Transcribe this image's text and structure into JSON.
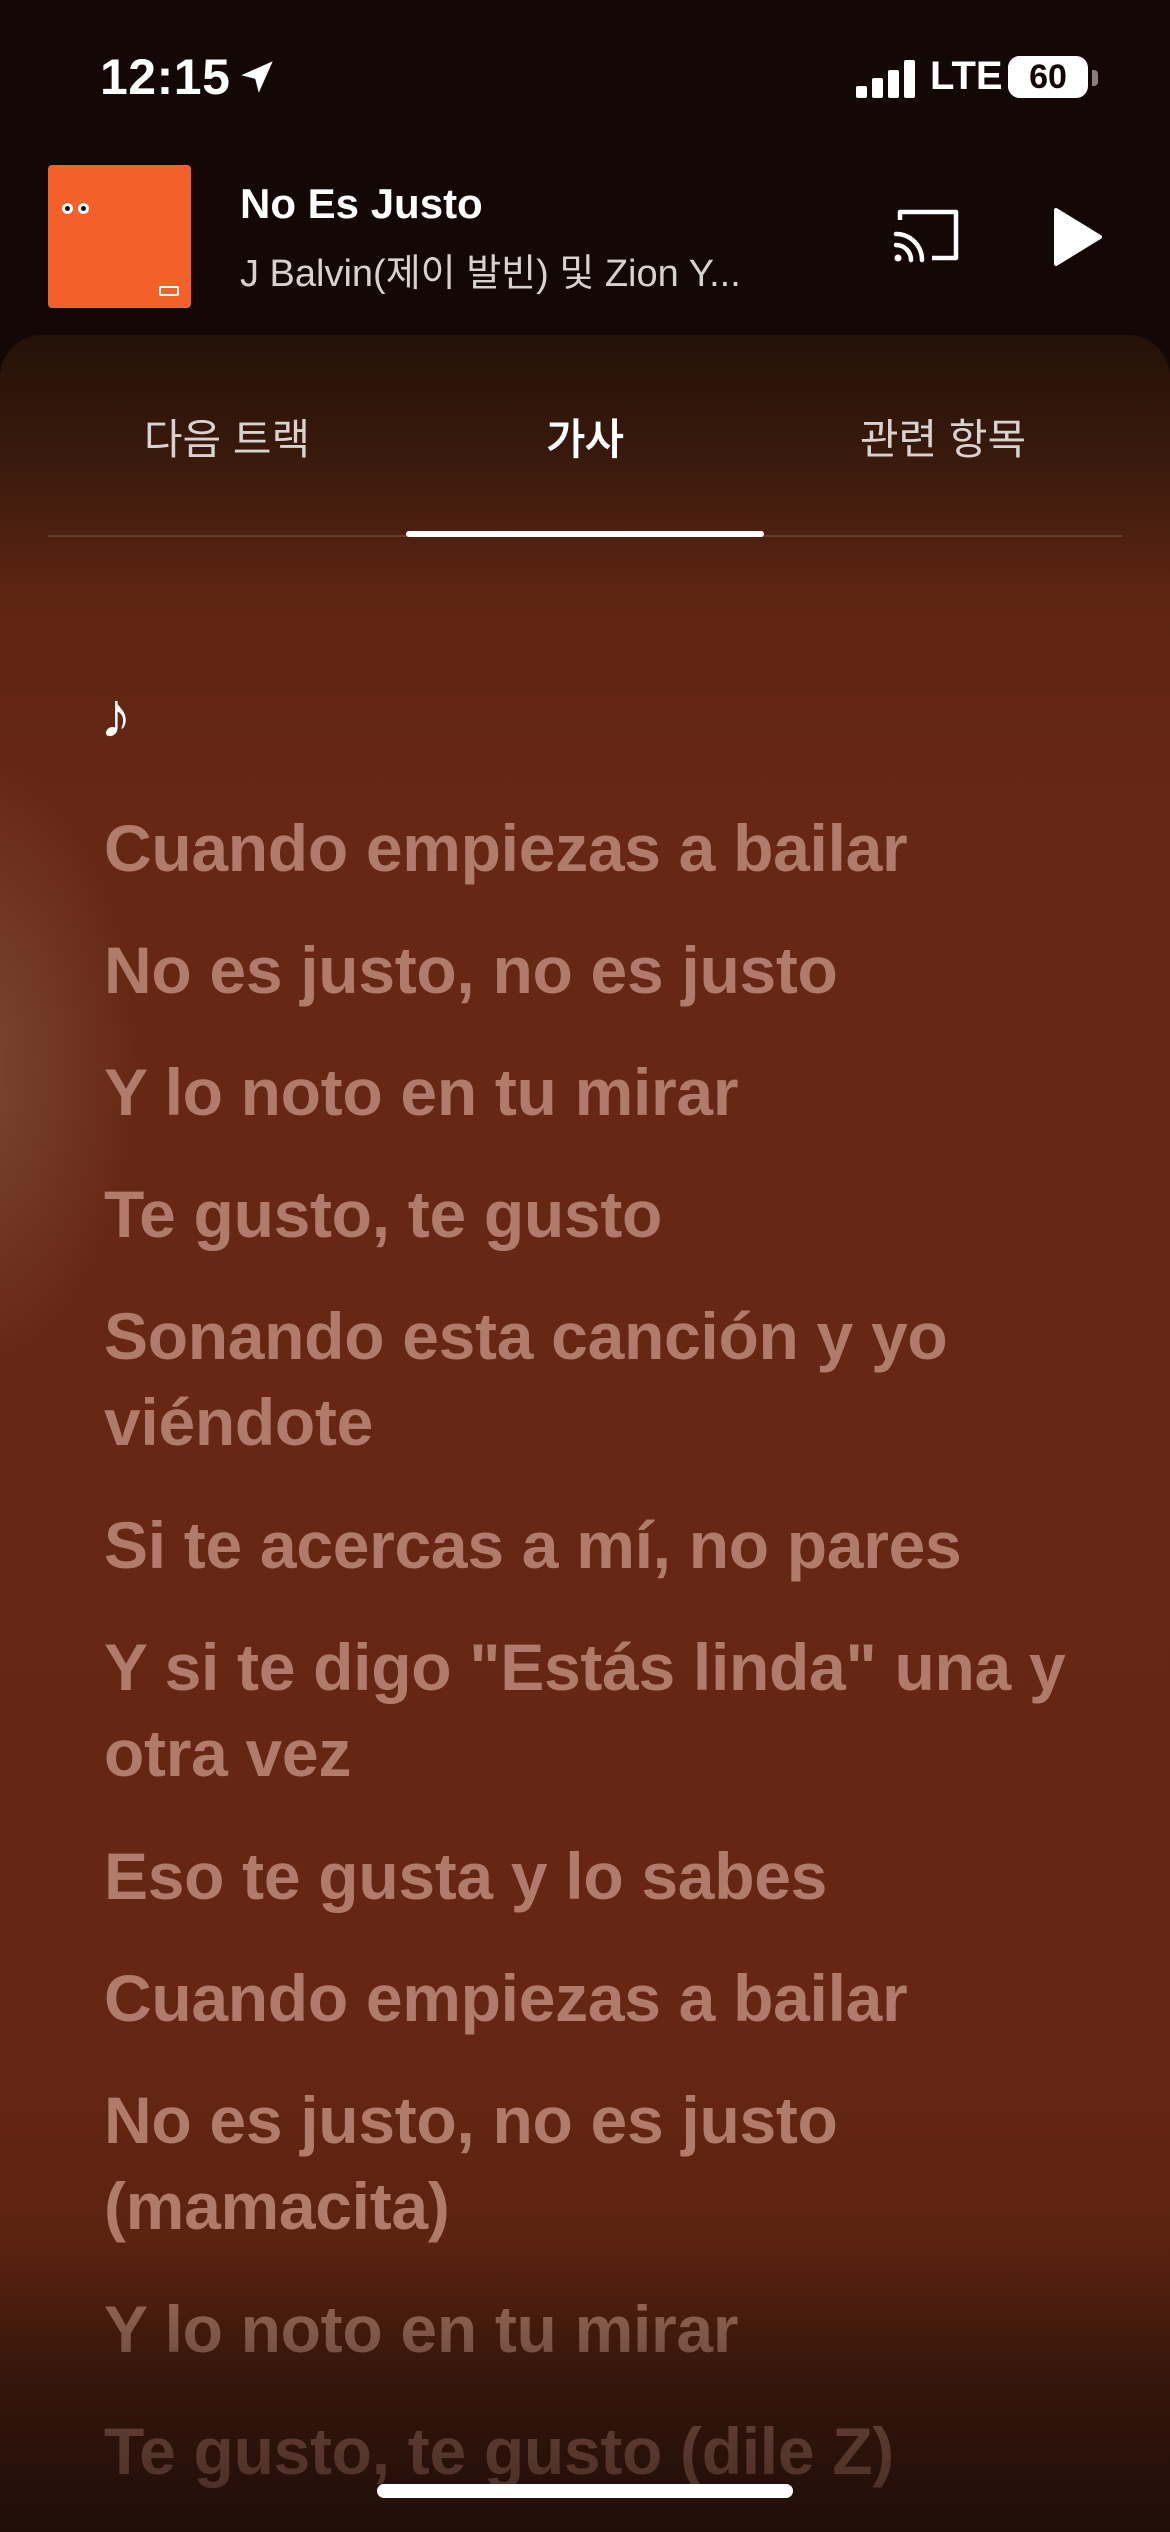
{
  "status_bar": {
    "time": "12:15",
    "network": "LTE",
    "battery": "60",
    "battery_level_percent": 60,
    "location_icon": "location-arrow-icon",
    "signal_icon": "cellular-signal-icon"
  },
  "mini_player": {
    "title": "No Es Justo",
    "artist": "J Balvin(제이 발빈) 및 Zion Y...",
    "album_art_color": "#f4602a",
    "cast_icon": "cast-icon",
    "play_icon": "play-icon"
  },
  "tabs": [
    {
      "label": "다음 트랙",
      "active": false
    },
    {
      "label": "가사",
      "active": true
    },
    {
      "label": "관련 항목",
      "active": false
    }
  ],
  "lyrics": {
    "intro_symbol": "♪",
    "lines": [
      "Cuando empiezas a bailar",
      "No es justo, no es justo",
      "Y lo noto en tu mirar",
      "Te gusto, te gusto",
      "Sonando esta canción y yo viéndote",
      "Si te acercas a mí, no pares",
      "Y si te digo \"Estás linda\" una y otra vez",
      "Eso te gusta y lo sabes",
      "Cuando empiezas a bailar",
      "No es justo, no es justo (mamacita)",
      "Y lo noto en tu mirar",
      "Te gusto, te gusto (dile Z)"
    ]
  },
  "colors": {
    "background": "#130806",
    "panel": "#662814",
    "lyric_text": "#b07b6b",
    "accent": "#ffffff"
  }
}
